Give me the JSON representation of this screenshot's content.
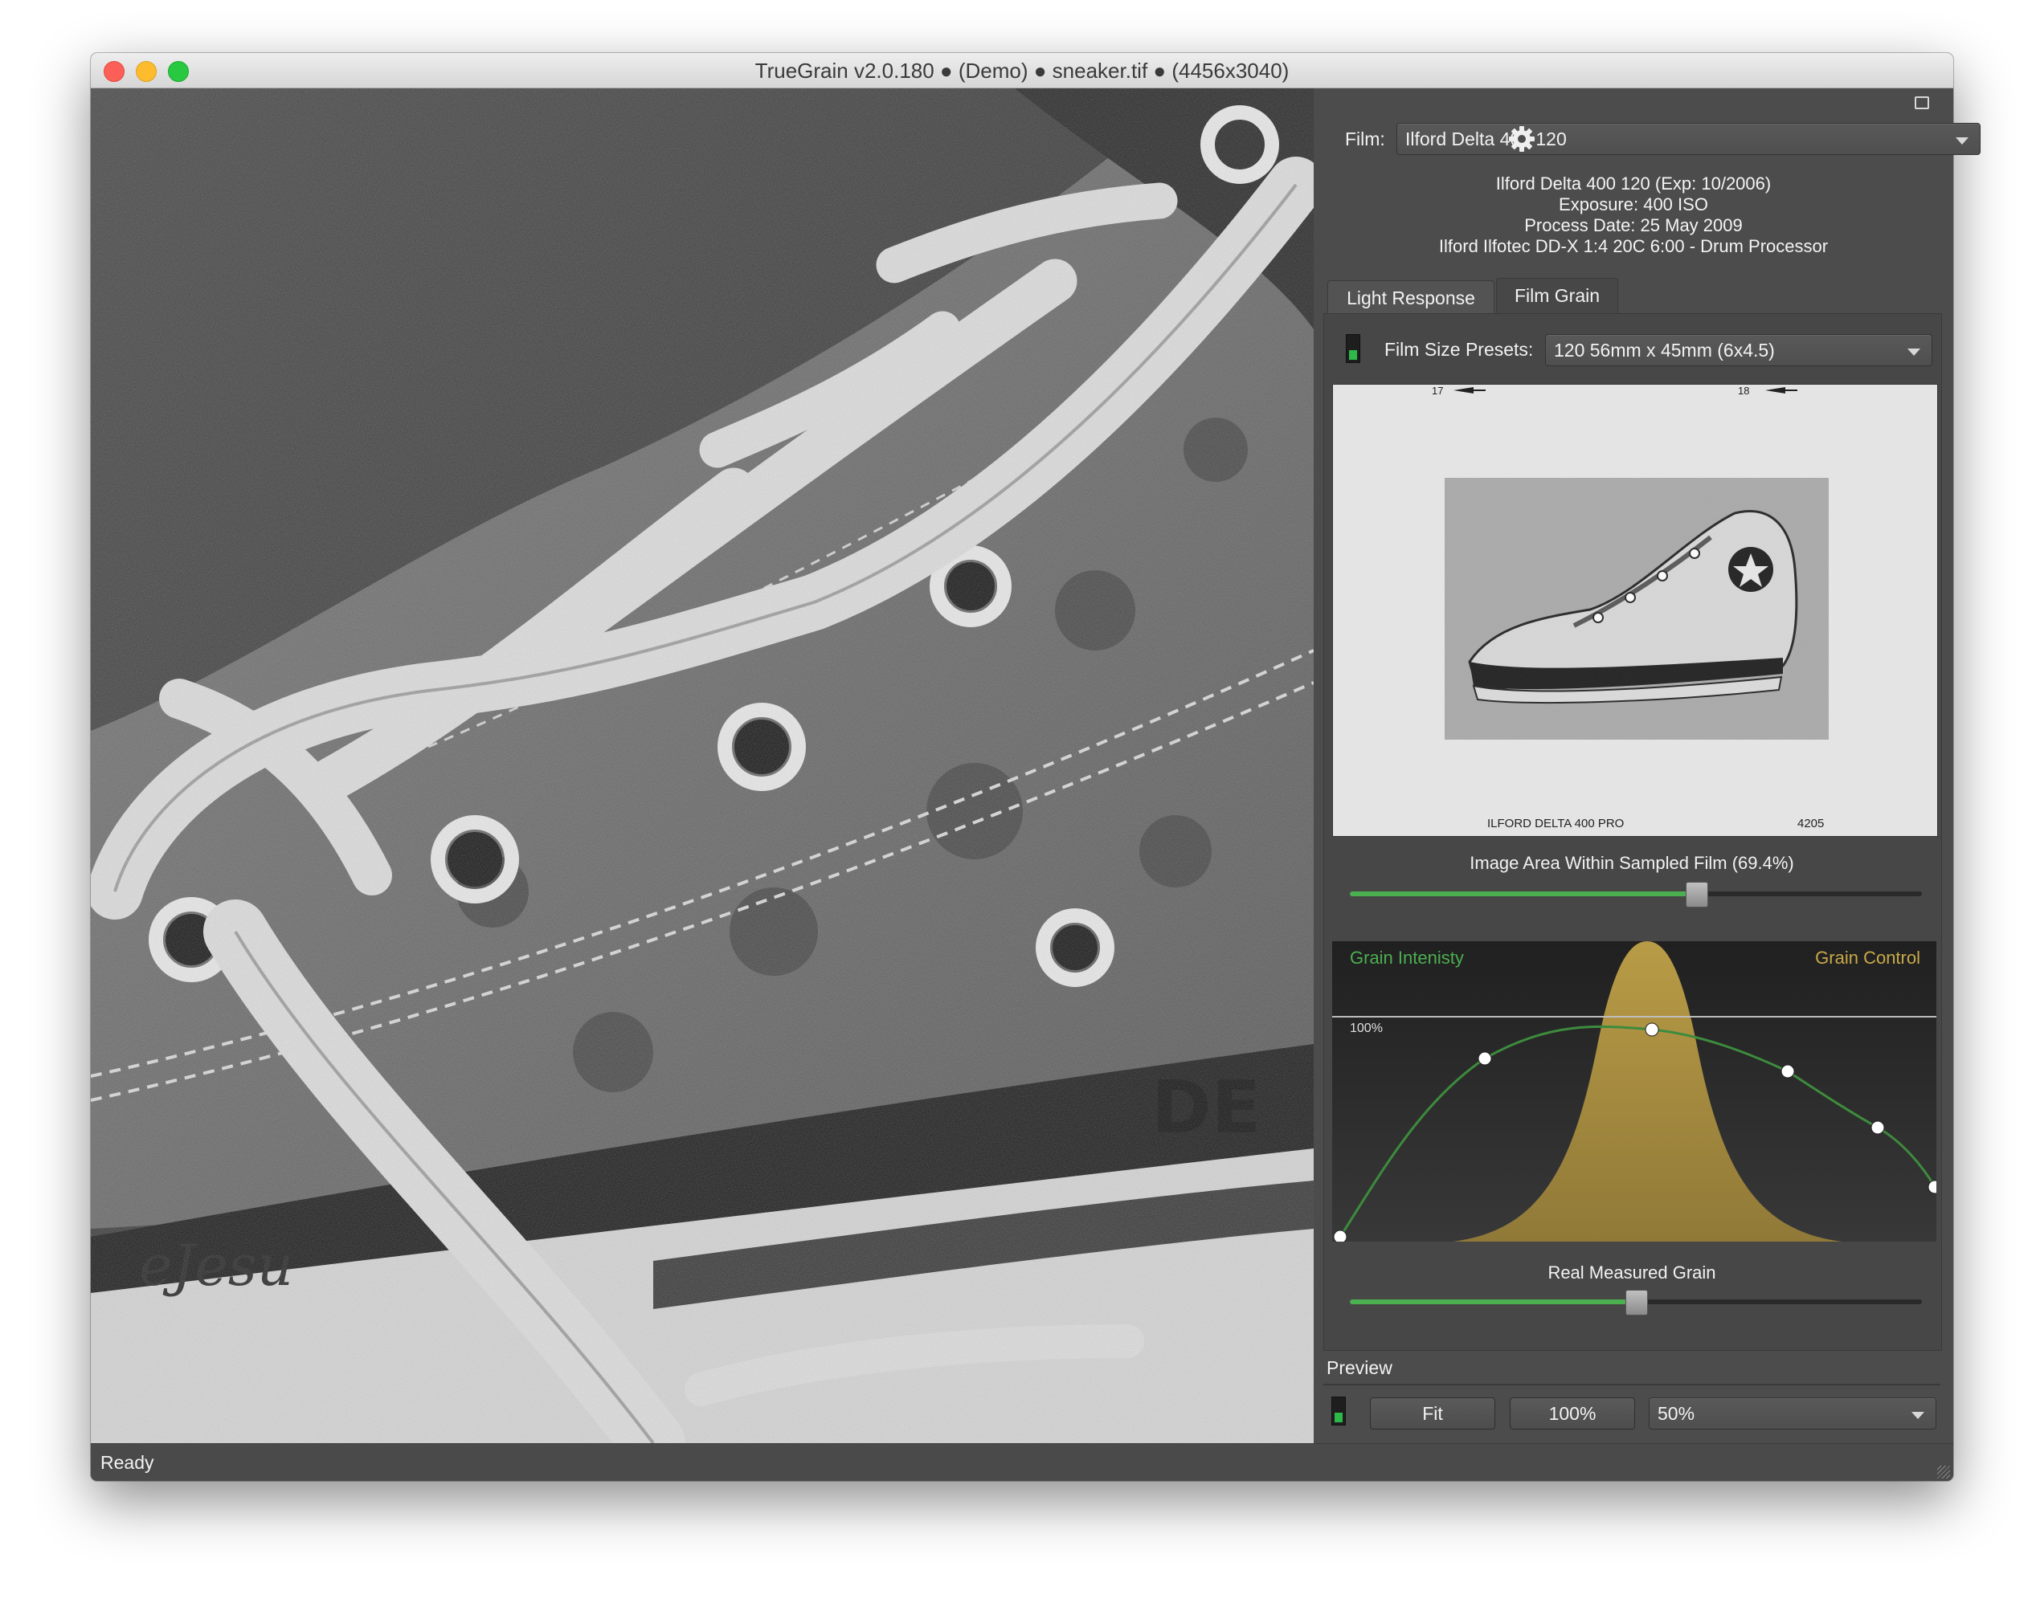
{
  "window": {
    "title": "TrueGrain v2.0.180 ● (Demo) ● sneaker.tif ● (4456x3040)"
  },
  "film": {
    "label": "Film:",
    "selected": "Ilford Delta 400 120",
    "info": [
      "Ilford Delta 400 120 (Exp: 10/2006)",
      "Exposure: 400 ISO",
      "Process Date: 25 May 2009",
      "Ilford Ilfotec DD-X 1:4 20C 6:00 - Drum Processor"
    ]
  },
  "tabs": [
    {
      "label": "Light Response",
      "active": false
    },
    {
      "label": "Film Grain",
      "active": true
    }
  ],
  "film_size": {
    "label": "Film Size Presets:",
    "selected": "120 56mm x 45mm (6x4.5)",
    "enabled": true
  },
  "film_edge": {
    "frame_left": "17",
    "frame_right": "18",
    "brand": "ILFORD DELTA 400 PRO",
    "code": "4205"
  },
  "image_area": {
    "label": "Image Area Within Sampled Film (69.4%)",
    "value": 0.605
  },
  "grain_curve": {
    "left_label": "Grain Intenisty",
    "right_label": "Grain Control",
    "reference_label": "100%",
    "colors": {
      "intensity": "#4caf50",
      "control": "#c9a94a"
    }
  },
  "grain_slider": {
    "label": "Real Measured Grain",
    "value": 0.5
  },
  "preview": {
    "title": "Preview",
    "enabled": true,
    "fit_label": "Fit",
    "full_label": "100%",
    "zoom_selected": "50%"
  },
  "status": {
    "text": "Ready"
  }
}
